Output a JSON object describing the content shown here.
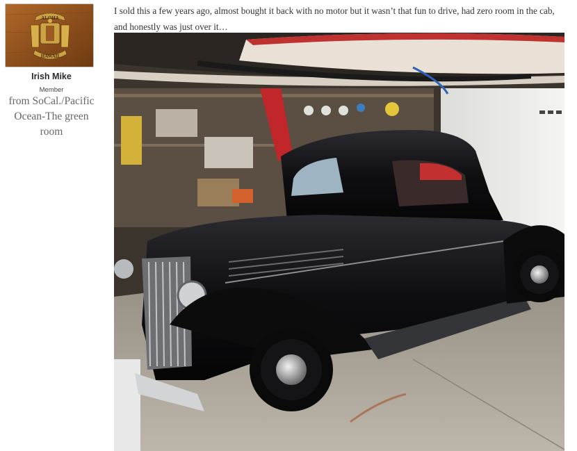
{
  "user": {
    "name": "Irish Mike",
    "title": "Member",
    "location": "from SoCal./Pacific Ocean-The green room",
    "avatar": {
      "top_text": "ALOHA",
      "bottom_text": "HAWAII",
      "colors": {
        "wood": "#9b5a22",
        "gold": "#d8b04a"
      }
    }
  },
  "post": {
    "text": "I sold this a few years ago, almost bought it back with no motor but it wasn’t that fun to drive, had zero room in the cab, and honestly was just over it…",
    "image": {
      "subject": "black-vintage-coupe-in-garage",
      "colors": {
        "car": "#121214",
        "garage_floor": "#b9b1a5",
        "surfboard": "#e9e1d5"
      }
    }
  }
}
